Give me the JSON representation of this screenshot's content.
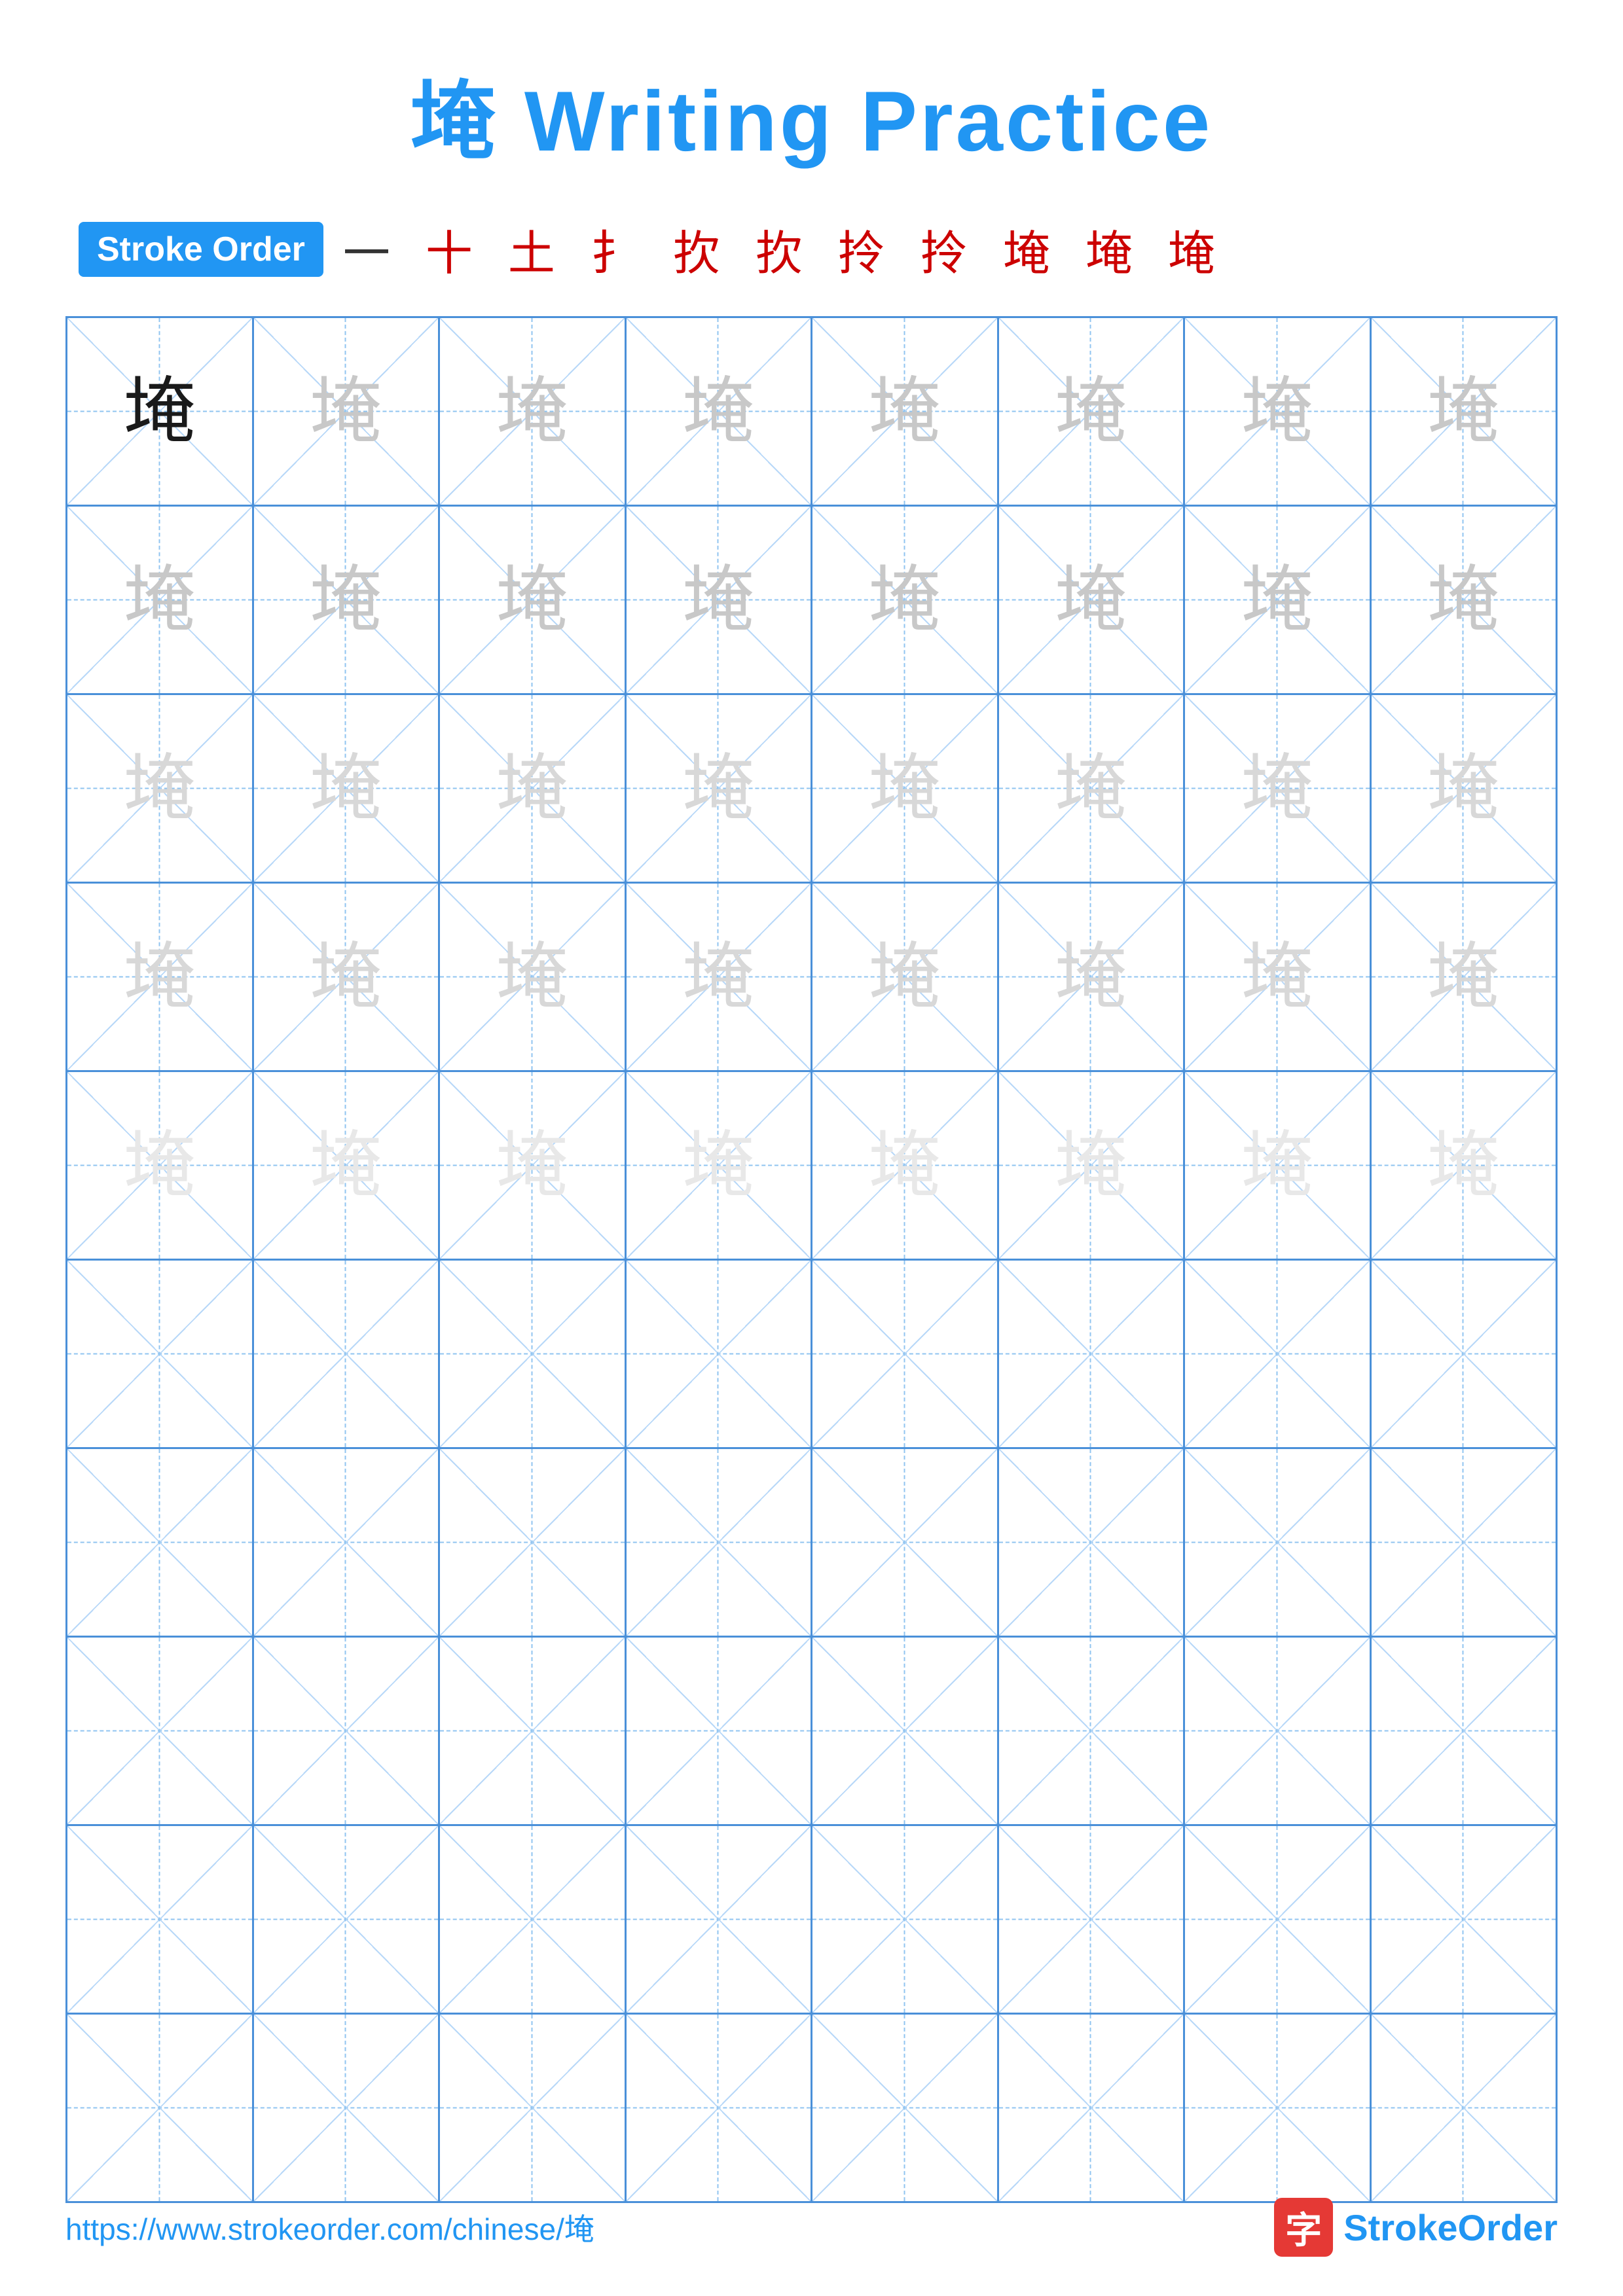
{
  "title": {
    "char": "埯",
    "text": " Writing Practice",
    "full": "埯 Writing Practice"
  },
  "stroke_order": {
    "badge": "Stroke Order",
    "strokes": [
      "一",
      "十",
      "土",
      "扌",
      "扻",
      "扻",
      "拎",
      "拎",
      "埯",
      "埯",
      "埯"
    ]
  },
  "grid": {
    "rows": 10,
    "cols": 8,
    "char": "埯",
    "guide_rows": [
      {
        "opacity": "dark"
      },
      {
        "opacity": "medium-light"
      },
      {
        "opacity": "lighter"
      },
      {
        "opacity": "lighter"
      },
      {
        "opacity": "lightest"
      },
      {
        "opacity": "empty"
      },
      {
        "opacity": "empty"
      },
      {
        "opacity": "empty"
      },
      {
        "opacity": "empty"
      },
      {
        "opacity": "empty"
      }
    ]
  },
  "footer": {
    "url": "https://www.strokeorder.com/chinese/埯",
    "brand_text": "StrokeOrder",
    "brand_char": "字"
  }
}
